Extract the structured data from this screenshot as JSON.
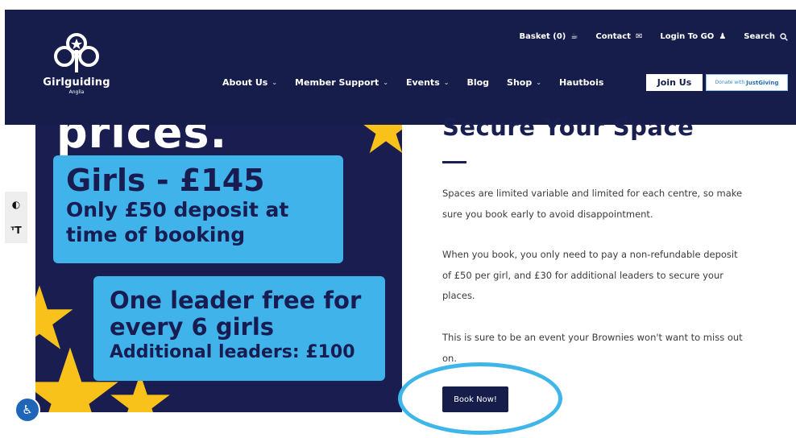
{
  "brand": {
    "name": "Girlguiding",
    "region": "Anglia"
  },
  "utility": {
    "basket_label": "Basket (0)",
    "contact_label": "Contact",
    "login_label": "Login To GO",
    "search_label": "Search"
  },
  "nav": {
    "items": [
      {
        "label": "About Us",
        "has_dropdown": true
      },
      {
        "label": "Member Support",
        "has_dropdown": true
      },
      {
        "label": "Events",
        "has_dropdown": true
      },
      {
        "label": "Blog",
        "has_dropdown": false
      },
      {
        "label": "Shop",
        "has_dropdown": true
      },
      {
        "label": "Hautbois",
        "has_dropdown": false
      }
    ],
    "join_label": "Join Us",
    "donate_prefix": "Donate with",
    "donate_brand": "JustGiving"
  },
  "hero": {
    "top_text": "prices.",
    "card1_big": "Girls - £145",
    "card1_line2": "Only £50 deposit at",
    "card1_line3": "time of booking",
    "card2_line1": "One leader free for",
    "card2_line2": "every 6 girls",
    "card2_line3": "Additional leaders: £100"
  },
  "content": {
    "title": "Secure Your Space",
    "p1": "Spaces are limited variable and limited for each centre, so make sure you book early to avoid disappointment.",
    "p2": "When you book, you only need to pay a non-refundable deposit of £50 per girl, and £30 for additional leaders to secure your places.",
    "p3": "This is sure to be an event your Brownies won't want to miss out on.",
    "book_label": "Book Now!"
  },
  "icons": {
    "contrast": "contrast-icon",
    "text_size": "text-size-icon",
    "accessibility": "accessibility-icon"
  },
  "colors": {
    "navy": "#171d4b",
    "sky_blue": "#3fb3ea",
    "star_yellow": "#f9c21b",
    "highlight_ring": "#3fb6e9"
  }
}
